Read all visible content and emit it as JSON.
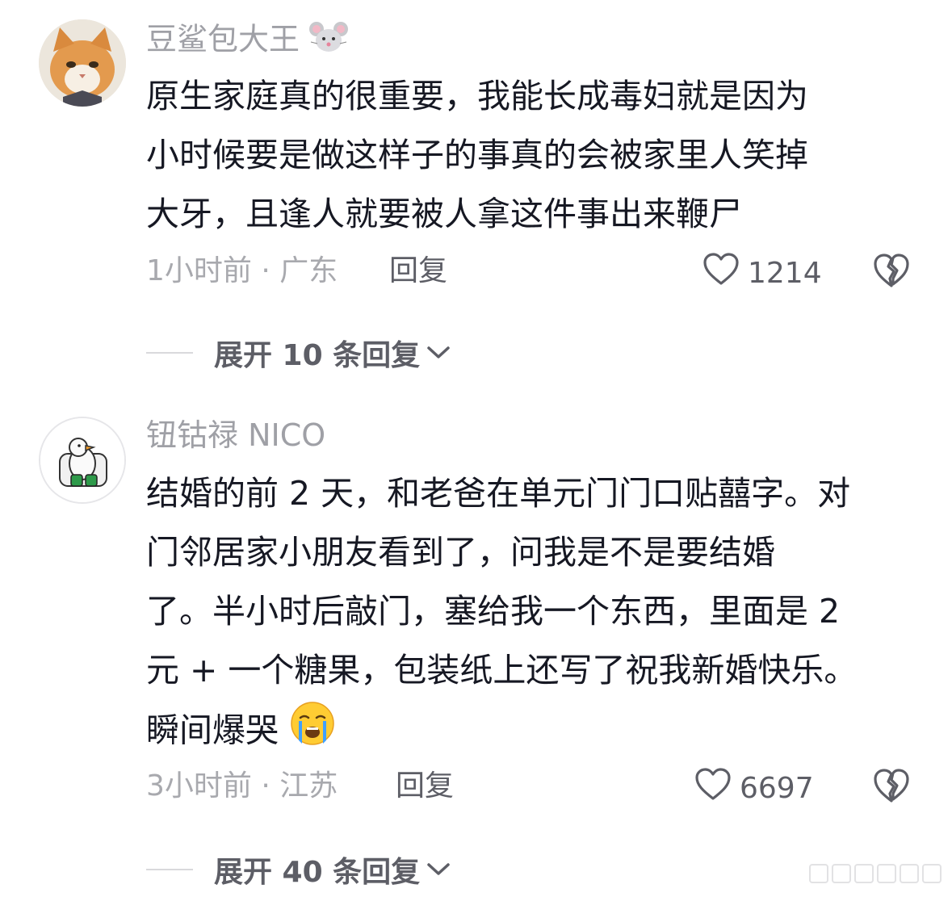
{
  "comments": [
    {
      "username": "豆鲨包大王",
      "username_emoji": "mouse-face",
      "lines": [
        "原生家庭真的很重要，我能长成毒妇就是因为",
        "小时候要是做这样子的事真的会被家里人笑掉",
        "大牙，且逢人就要被人拿这件事出来鞭尸"
      ],
      "meta": "1小时前 · 广东",
      "reply_label": "回复",
      "likes": "1214",
      "expand_label": "展开 10 条回复"
    },
    {
      "username": "钮钴禄 NICO",
      "lines": [
        "结婚的前 2 天，和老爸在单元门门口贴囍字。对",
        "门邻居家小朋友看到了，问我是不是要结婚",
        "了。半小时后敲门，塞给我一个东西，里面是 2",
        "元 + 一个糖果，包装纸上还写了祝我新婚快乐。",
        "瞬间爆哭"
      ],
      "trailing_emoji": "crying-face",
      "meta": "3小时前 · 江苏",
      "reply_label": "回复",
      "likes": "6697",
      "expand_label": "展开 40 条回复"
    }
  ],
  "icons": {
    "like": "heart-outline-icon",
    "dislike": "broken-heart-icon",
    "expand": "chevron-down-icon"
  },
  "colors": {
    "username": "#9fa0a6",
    "body": "#161823",
    "meta": "#a8a9ae",
    "action": "#5d5e66"
  }
}
